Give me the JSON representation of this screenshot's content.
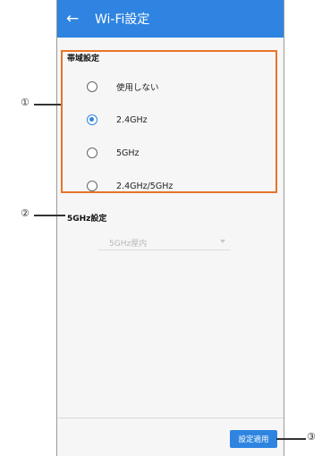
{
  "appbar": {
    "title": "Wi-Fi設定",
    "back_icon": "arrow-left-icon"
  },
  "band_section": {
    "title": "帯域設定",
    "options": [
      {
        "label": "使用しない",
        "checked": false
      },
      {
        "label": "2.4GHz",
        "checked": true
      },
      {
        "label": "5GHz",
        "checked": false
      },
      {
        "label": "2.4GHz/5GHz",
        "checked": false
      }
    ]
  },
  "five_ghz_section": {
    "title": "5GHz設定",
    "select_value": "5GHz屋内"
  },
  "footer": {
    "apply_label": "設定適用"
  },
  "callouts": {
    "one": "①",
    "two": "②",
    "three": "③"
  },
  "colors": {
    "accent": "#2e84e0",
    "highlight": "#e8742a"
  }
}
